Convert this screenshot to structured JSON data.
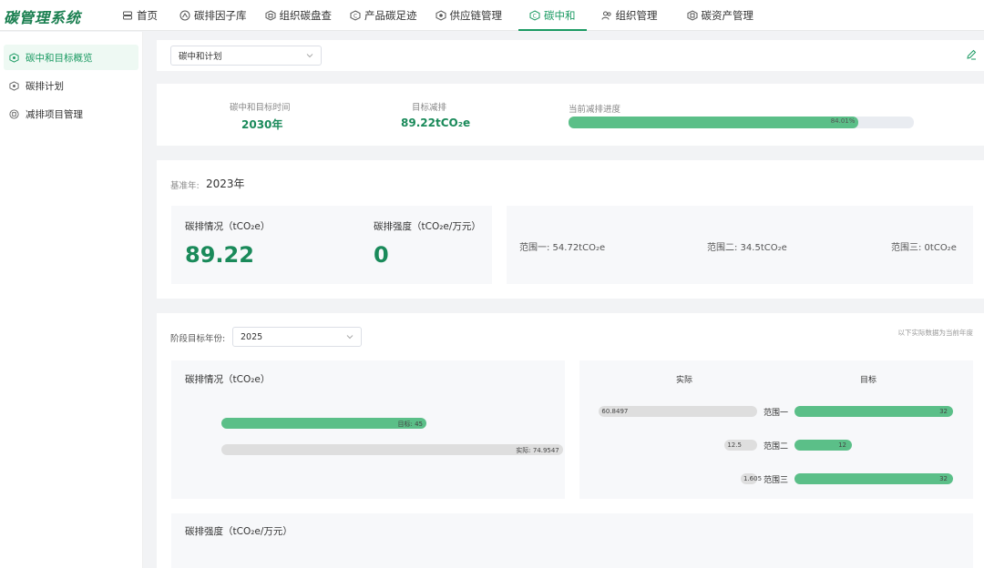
{
  "app": {
    "title": "碳管理系统"
  },
  "nav": [
    {
      "label": "首页",
      "icon": "home-icon"
    },
    {
      "label": "碳排因子库",
      "icon": "factor-icon"
    },
    {
      "label": "组织碳盘查",
      "icon": "org-check-icon"
    },
    {
      "label": "产品碳足迹",
      "icon": "product-icon"
    },
    {
      "label": "供应链管理",
      "icon": "supply-icon"
    },
    {
      "label": "碳中和",
      "icon": "neutral-icon",
      "active": true
    },
    {
      "label": "组织管理",
      "icon": "users-icon"
    },
    {
      "label": "碳资产管理",
      "icon": "asset-icon"
    }
  ],
  "sidebar": {
    "items": [
      {
        "label": "碳中和目标概览",
        "icon": "overview-icon",
        "active": true
      },
      {
        "label": "碳排计划",
        "icon": "plan-icon"
      },
      {
        "label": "减排项目管理",
        "icon": "project-icon"
      }
    ]
  },
  "plan_select": {
    "value": "碳中和计划"
  },
  "summary": {
    "target_time_label": "碳中和目标时间",
    "target_time_value": "2030年",
    "target_reduction_label": "目标减排",
    "target_reduction_value": "89.22tCO₂e",
    "progress_label": "当前减排进度",
    "progress_percent": 84.01,
    "progress_text": "84.01%"
  },
  "baseline": {
    "year_label": "基准年:",
    "year_value": "2023年",
    "emission_title": "碳排情况（tCO₂e）",
    "emission_value": "89.22",
    "intensity_title": "碳排强度（tCO₂e/万元）",
    "intensity_value": "0",
    "scope1": "范围一: 54.72tCO₂e",
    "scope2": "范围二: 34.5tCO₂e",
    "scope3": "范围三: 0tCO₂e"
  },
  "stage": {
    "year_label": "阶段目标年份:",
    "year_value": "2025",
    "note": "以下实际数据为当前年度",
    "emission_card_title": "碳排情况（tCO₂e）",
    "intensity_card_title": "碳排强度（tCO₂e/万元）",
    "target_bar_label": "目标: 45",
    "actual_bar_label": "实际: 74.9547",
    "actual_header": "实际",
    "target_header": "目标"
  },
  "chart_data": [
    {
      "type": "bar",
      "title": "碳排情况（tCO₂e）",
      "categories": [
        "目标",
        "实际"
      ],
      "values": [
        45,
        74.9547
      ]
    },
    {
      "type": "bar",
      "categories": [
        "范围一",
        "范围二",
        "范围三"
      ],
      "series": [
        {
          "name": "实际",
          "values": [
            60.8497,
            12.5,
            1.605
          ]
        },
        {
          "name": "目标",
          "values": [
            32,
            12,
            32
          ]
        }
      ],
      "value_labels": {
        "实际": [
          "60.8497",
          "12.5",
          "1.605"
        ],
        "目标": [
          "32",
          "12",
          "32"
        ]
      }
    }
  ],
  "colors": {
    "accent": "#1a9a62",
    "bar_green": "#5bbf88",
    "bar_grey": "#dedede"
  }
}
